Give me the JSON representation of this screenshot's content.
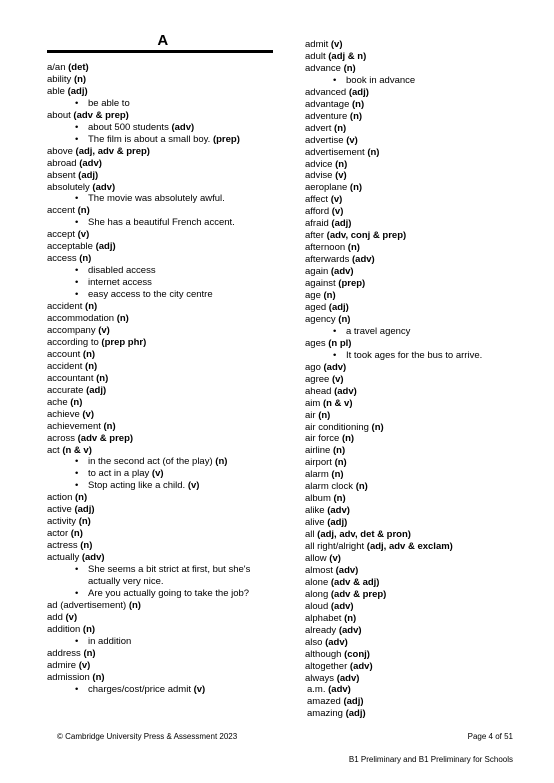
{
  "document": {
    "section_letter": "A",
    "bullet_glyph": "•"
  },
  "left_column": [
    {
      "type": "entry",
      "word": "a/an ",
      "pos": "(det)"
    },
    {
      "type": "entry",
      "word": "ability  ",
      "pos": "(n)"
    },
    {
      "type": "entry",
      "word": "able ",
      "pos": "(adj)"
    },
    {
      "type": "example",
      "text": "be able to",
      "pos": ""
    },
    {
      "type": "entry",
      "word": "about ",
      "pos": "(adv & prep)"
    },
    {
      "type": "example",
      "text": "about 500 students ",
      "pos": "(adv)"
    },
    {
      "type": "example",
      "text": "The film is about a small boy. ",
      "pos": "(prep)"
    },
    {
      "type": "entry",
      "word": "above ",
      "pos": "(adj, adv & prep)"
    },
    {
      "type": "entry",
      "word": "abroad ",
      "pos": "(adv)"
    },
    {
      "type": "entry",
      "word": "absent ",
      "pos": "(adj)"
    },
    {
      "type": "entry",
      "word": "absolutely ",
      "pos": "(adv)"
    },
    {
      "type": "example",
      "text": "The movie was absolutely awful.",
      "pos": ""
    },
    {
      "type": "entry",
      "word": "accent ",
      "pos": "(n)"
    },
    {
      "type": "example",
      "text": "She has a beautiful French accent.",
      "pos": ""
    },
    {
      "type": "entry",
      "word": "accept ",
      "pos": "(v)"
    },
    {
      "type": "entry",
      "word": "acceptable ",
      "pos": "(adj)"
    },
    {
      "type": "entry",
      "word": "access ",
      "pos": "(n)"
    },
    {
      "type": "example",
      "text": "disabled access",
      "pos": ""
    },
    {
      "type": "example",
      "text": "internet access",
      "pos": ""
    },
    {
      "type": "example",
      "text": "easy access to the city centre",
      "pos": ""
    },
    {
      "type": "entry",
      "word": "accident ",
      "pos": "(n)"
    },
    {
      "type": "entry",
      "word": "accommodation ",
      "pos": "(n)"
    },
    {
      "type": "entry",
      "word": "accompany ",
      "pos": "(v)"
    },
    {
      "type": "entry",
      "word": "according to ",
      "pos": "(prep phr)"
    },
    {
      "type": "entry",
      "word": "account ",
      "pos": "(n)"
    },
    {
      "type": "entry",
      "word": "accident ",
      "pos": "(n)"
    },
    {
      "type": "entry",
      "word": "accountant ",
      "pos": "(n)"
    },
    {
      "type": "entry",
      "word": "accurate ",
      "pos": "(adj)"
    },
    {
      "type": "entry",
      "word": "ache ",
      "pos": "(n)"
    },
    {
      "type": "entry",
      "word": "achieve ",
      "pos": "(v)"
    },
    {
      "type": "entry",
      "word": "achievement ",
      "pos": "(n)"
    },
    {
      "type": "entry",
      "word": "across ",
      "pos": "(adv & prep)"
    },
    {
      "type": "entry",
      "word": "act ",
      "pos": "(n & v)"
    },
    {
      "type": "example",
      "text": "in the second act (of the play) ",
      "pos": "(n)"
    },
    {
      "type": "example",
      "text": "to act in a play ",
      "pos": "(v)"
    },
    {
      "type": "example",
      "text": "Stop acting like a child. ",
      "pos": "(v)"
    },
    {
      "type": "entry",
      "word": "action ",
      "pos": "(n)"
    },
    {
      "type": "entry",
      "word": "active ",
      "pos": "(adj)"
    },
    {
      "type": "entry",
      "word": "activity ",
      "pos": "(n)"
    },
    {
      "type": "entry",
      "word": "actor ",
      "pos": "(n)"
    },
    {
      "type": "entry",
      "word": "actress ",
      "pos": "(n)"
    },
    {
      "type": "entry",
      "word": "actually ",
      "pos": "(adv)"
    },
    {
      "type": "example",
      "text": "She seems a bit strict at first, but she's actually very nice.",
      "pos": "",
      "wrap": true
    },
    {
      "type": "example",
      "text": "Are you actually going to take the job?",
      "pos": ""
    },
    {
      "type": "entry",
      "word": "ad (advertisement) ",
      "pos": "(n)"
    },
    {
      "type": "entry",
      "word": "add ",
      "pos": "(v)"
    },
    {
      "type": "entry",
      "word": "addition ",
      "pos": "(n)"
    },
    {
      "type": "example",
      "text": "in addition",
      "pos": ""
    },
    {
      "type": "entry",
      "word": "address ",
      "pos": "(n)"
    },
    {
      "type": "entry",
      "word": "admire ",
      "pos": "(v)"
    },
    {
      "type": "entry",
      "word": "admission ",
      "pos": "(n)"
    },
    {
      "type": "example",
      "text": "charges/cost/price admit ",
      "pos": "(v)"
    }
  ],
  "right_column": [
    {
      "type": "entry",
      "word": "admit ",
      "pos": "(v)"
    },
    {
      "type": "entry",
      "word": "adult ",
      "pos": "(adj & n)"
    },
    {
      "type": "entry",
      "word": "advance ",
      "pos": "(n)"
    },
    {
      "type": "example",
      "text": "book in advance",
      "pos": ""
    },
    {
      "type": "entry",
      "word": "advanced ",
      "pos": "(adj)"
    },
    {
      "type": "entry",
      "word": "advantage ",
      "pos": "(n)"
    },
    {
      "type": "entry",
      "word": "adventure ",
      "pos": "(n)"
    },
    {
      "type": "entry",
      "word": "advert ",
      "pos": "(n)"
    },
    {
      "type": "entry",
      "word": "advertise ",
      "pos": "(v)"
    },
    {
      "type": "entry",
      "word": "advertisement ",
      "pos": "(n)"
    },
    {
      "type": "entry",
      "word": "advice ",
      "pos": "(n)"
    },
    {
      "type": "entry",
      "word": "advise ",
      "pos": "(v)"
    },
    {
      "type": "entry",
      "word": "aeroplane ",
      "pos": "(n)"
    },
    {
      "type": "entry",
      "word": "affect ",
      "pos": "(v)"
    },
    {
      "type": "entry",
      "word": "afford ",
      "pos": "(v)"
    },
    {
      "type": "entry",
      "word": "afraid ",
      "pos": "(adj)"
    },
    {
      "type": "entry",
      "word": "after ",
      "pos": "(adv, conj & prep)"
    },
    {
      "type": "entry",
      "word": "afternoon ",
      "pos": "(n)"
    },
    {
      "type": "entry",
      "word": "afterwards ",
      "pos": "(adv)"
    },
    {
      "type": "entry",
      "word": "again ",
      "pos": "(adv)"
    },
    {
      "type": "entry",
      "word": "against ",
      "pos": "(prep)"
    },
    {
      "type": "entry",
      "word": "age ",
      "pos": "(n)"
    },
    {
      "type": "entry",
      "word": "aged ",
      "pos": "(adj)"
    },
    {
      "type": "entry",
      "word": "agency ",
      "pos": "(n)"
    },
    {
      "type": "example",
      "text": "a travel agency",
      "pos": ""
    },
    {
      "type": "entry",
      "word": "ages ",
      "pos": "(n pl)"
    },
    {
      "type": "example",
      "text": "It took ages for the bus to arrive.",
      "pos": ""
    },
    {
      "type": "entry",
      "word": "ago ",
      "pos": "(adv)"
    },
    {
      "type": "entry",
      "word": "agree ",
      "pos": "(v)"
    },
    {
      "type": "entry",
      "word": "ahead ",
      "pos": "(adv)"
    },
    {
      "type": "entry",
      "word": "aim ",
      "pos": "(n & v)"
    },
    {
      "type": "entry",
      "word": "air ",
      "pos": "(n)"
    },
    {
      "type": "entry",
      "word": "air conditioning ",
      "pos": "(n)"
    },
    {
      "type": "entry",
      "word": "air force ",
      "pos": "(n)"
    },
    {
      "type": "entry",
      "word": "airline ",
      "pos": "(n)"
    },
    {
      "type": "entry",
      "word": "airport ",
      "pos": "(n)"
    },
    {
      "type": "entry",
      "word": "alarm ",
      "pos": "(n)"
    },
    {
      "type": "entry",
      "word": "alarm clock ",
      "pos": "(n)"
    },
    {
      "type": "entry",
      "word": "album ",
      "pos": "(n)"
    },
    {
      "type": "entry",
      "word": "alike ",
      "pos": "(adv)"
    },
    {
      "type": "entry",
      "word": "alive ",
      "pos": "(adj)"
    },
    {
      "type": "entry",
      "word": "all ",
      "pos": "(adj, adv, det & pron)"
    },
    {
      "type": "entry",
      "word": "all right/alright ",
      "pos": "(adj, adv & exclam)"
    },
    {
      "type": "entry",
      "word": "allow ",
      "pos": "(v)"
    },
    {
      "type": "entry",
      "word": "almost ",
      "pos": "(adv)"
    },
    {
      "type": "entry",
      "word": "alone ",
      "pos": "(adv & adj)"
    },
    {
      "type": "entry",
      "word": "along ",
      "pos": "(adv & prep)"
    },
    {
      "type": "entry",
      "word": "aloud ",
      "pos": "(adv)"
    },
    {
      "type": "entry",
      "word": "alphabet ",
      "pos": "(n)"
    },
    {
      "type": "entry",
      "word": "already ",
      "pos": "(adv)"
    },
    {
      "type": "entry",
      "word": "also ",
      "pos": "(adv)"
    },
    {
      "type": "entry",
      "word": "although ",
      "pos": "(conj)"
    },
    {
      "type": "entry",
      "word": "altogether ",
      "pos": "(adv)"
    },
    {
      "type": "entry",
      "word": "always ",
      "pos": "(adv)"
    },
    {
      "type": "entry",
      "word": "a.m. ",
      "pos": "(adv)",
      "indented": true
    },
    {
      "type": "entry",
      "word": "amazed ",
      "pos": "(adj)",
      "indented": true
    },
    {
      "type": "entry",
      "word": "amazing ",
      "pos": "(adj)",
      "indented": true
    }
  ],
  "footer": {
    "copyright": "© Cambridge University Press & Assessment 2023",
    "page": "Page 4 of 51",
    "exam": "B1 Preliminary and B1 Preliminary for Schools"
  }
}
